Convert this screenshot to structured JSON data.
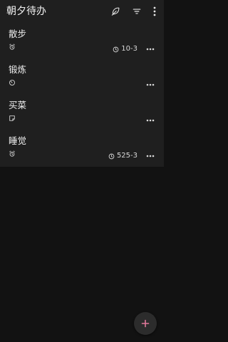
{
  "app": {
    "title": "朝夕待办"
  },
  "header": {
    "icons": [
      "feather-icon",
      "filter-icon",
      "more-vert-icon"
    ]
  },
  "colors": {
    "background": "#121212",
    "surface": "#1f1f1f",
    "text": "#ececec",
    "fab_plus": "#e0789a"
  },
  "todos": [
    {
      "name": "散步",
      "kind_icon": "alarm-icon",
      "reminder": "10-3"
    },
    {
      "name": "锻炼",
      "kind_icon": "timer-icon",
      "reminder": ""
    },
    {
      "name": "买菜",
      "kind_icon": "note-icon",
      "reminder": ""
    },
    {
      "name": "睡觉",
      "kind_icon": "alarm-icon",
      "reminder": "525-3"
    }
  ],
  "fab": {
    "icon": "plus-icon"
  }
}
